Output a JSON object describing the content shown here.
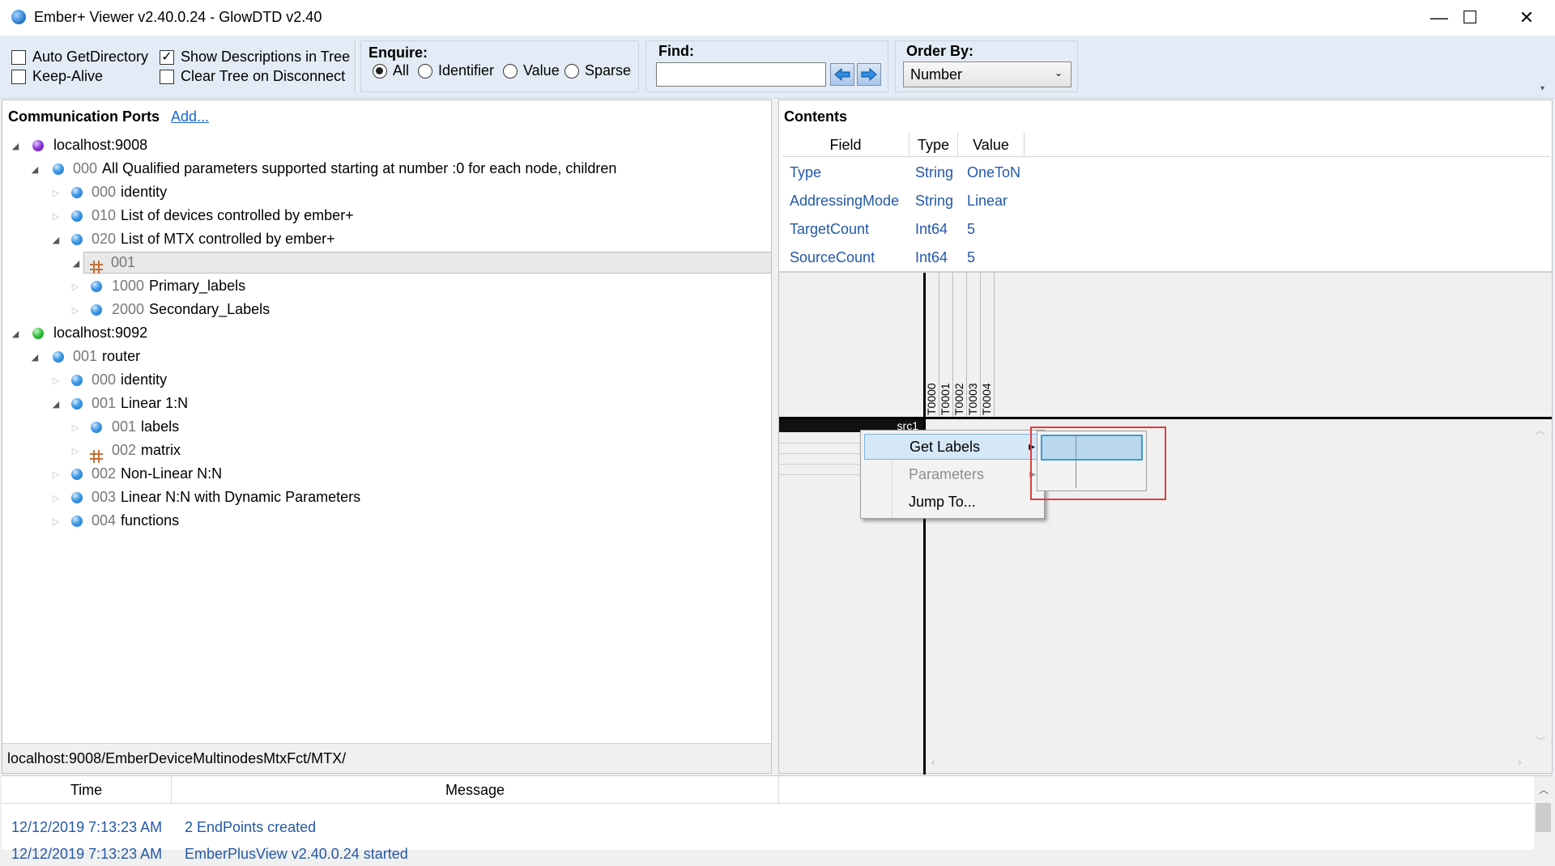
{
  "window": {
    "title": "Ember+ Viewer v2.40.0.24 - GlowDTD v2.40",
    "minimize": "—",
    "maximize": "☐",
    "close": "✕"
  },
  "toolbar": {
    "auto_getdirectory": {
      "label": "Auto GetDirectory",
      "checked": false
    },
    "keep_alive": {
      "label": "Keep-Alive",
      "checked": false
    },
    "show_descriptions": {
      "label": "Show Descriptions in Tree",
      "checked": true,
      "mark": "✓"
    },
    "clear_tree": {
      "label": "Clear Tree on Disconnect",
      "checked": false
    },
    "enquire": {
      "label": "Enquire:",
      "options": [
        "All",
        "Identifier",
        "Value",
        "Sparse"
      ],
      "selected": "All"
    },
    "find": {
      "label": "Find:",
      "value": ""
    },
    "order_by": {
      "label": "Order By:",
      "value": "Number"
    }
  },
  "ports_panel": {
    "title": "Communication Ports",
    "add_link": "Add...",
    "tree": [
      {
        "num": "",
        "label": "localhost:9008",
        "icon": "ball-purple"
      },
      {
        "num": "000",
        "label": "All Qualified parameters supported starting at number :0 for each node, children",
        "icon": "ball-blue"
      },
      {
        "num": "000",
        "label": "identity",
        "icon": "ball-blue"
      },
      {
        "num": "010",
        "label": "List of devices controlled by ember+",
        "icon": "ball-blue"
      },
      {
        "num": "020",
        "label": "List of MTX controlled by ember+",
        "icon": "ball-blue"
      },
      {
        "num": "001",
        "label": "",
        "icon": "matrix"
      },
      {
        "num": "1000",
        "label": "Primary_labels",
        "icon": "ball-blue"
      },
      {
        "num": "2000",
        "label": "Secondary_Labels",
        "icon": "ball-blue"
      },
      {
        "num": "",
        "label": "localhost:9092",
        "icon": "ball-green"
      },
      {
        "num": "001",
        "label": "router",
        "icon": "ball-blue"
      },
      {
        "num": "000",
        "label": "identity",
        "icon": "ball-blue"
      },
      {
        "num": "001",
        "label": "Linear 1:N",
        "icon": "ball-blue"
      },
      {
        "num": "001",
        "label": "labels",
        "icon": "ball-blue"
      },
      {
        "num": "002",
        "label": "matrix",
        "icon": "matrix"
      },
      {
        "num": "002",
        "label": "Non-Linear N:N",
        "icon": "ball-blue"
      },
      {
        "num": "003",
        "label": "Linear N:N with Dynamic Parameters",
        "icon": "ball-blue"
      },
      {
        "num": "004",
        "label": "functions",
        "icon": "ball-blue"
      }
    ],
    "status_path": "localhost:9008/EmberDeviceMultinodesMtxFct/MTX/"
  },
  "contents_panel": {
    "title": "Contents",
    "columns": [
      "Field",
      "Type",
      "Value"
    ],
    "rows": [
      {
        "field": "Type",
        "type": "String",
        "value": "OneToN"
      },
      {
        "field": "AddressingMode",
        "type": "String",
        "value": "Linear"
      },
      {
        "field": "TargetCount",
        "type": "Int64",
        "value": "5"
      },
      {
        "field": "SourceCount",
        "type": "Int64",
        "value": "5"
      }
    ]
  },
  "matrix_view": {
    "targets": [
      "T0000",
      "T0001",
      "T0002",
      "T0003",
      "T0004"
    ],
    "source_label": "src1"
  },
  "context_menu": {
    "items": [
      {
        "label": "Get Labels",
        "submenu": true,
        "selected": true,
        "disabled": false
      },
      {
        "label": "Parameters",
        "submenu": true,
        "selected": false,
        "disabled": true
      },
      {
        "label": "Jump To...",
        "submenu": false,
        "selected": false,
        "disabled": false
      }
    ]
  },
  "log": {
    "columns": [
      "Time",
      "Message"
    ],
    "rows": [
      {
        "time": "12/12/2019 7:13:23 AM",
        "message": "2 EndPoints created"
      },
      {
        "time": "12/12/2019 7:13:23 AM",
        "message": "EmberPlusView v2.40.0.24 started"
      }
    ]
  },
  "colors": {
    "toolbar_bg": "#e3ecf6",
    "link_blue": "#1a66d9",
    "value_blue": "#2458a8",
    "highlight_red": "#e03c3c"
  }
}
